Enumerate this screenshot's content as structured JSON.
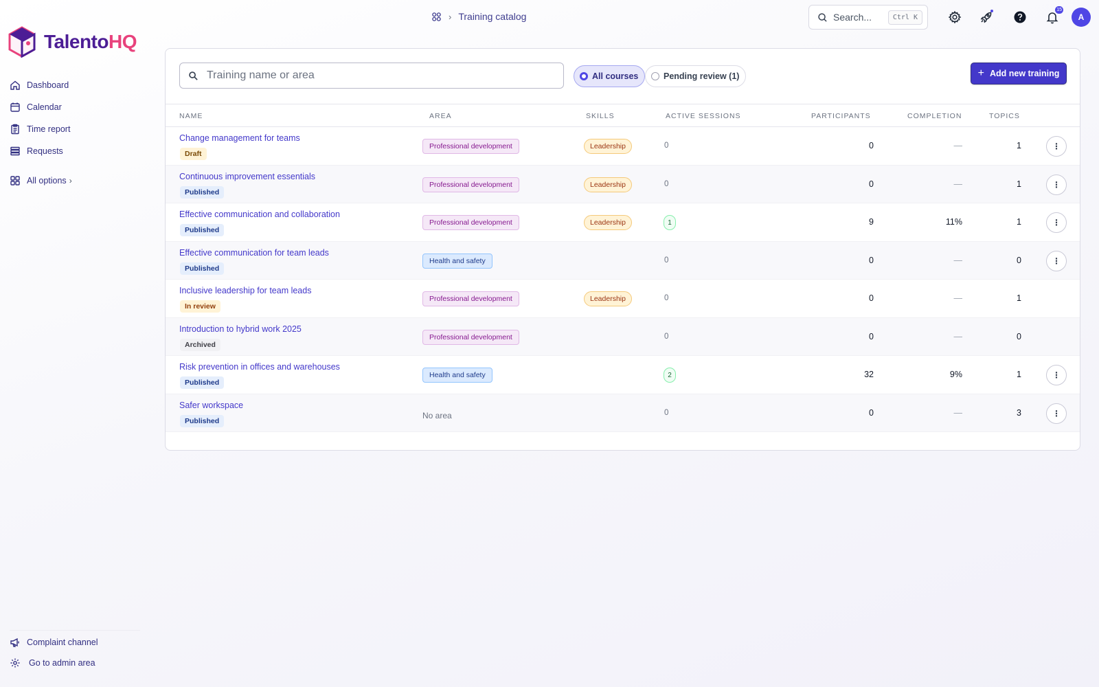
{
  "brand": {
    "name_main": "Talento",
    "name_accent": "HQ"
  },
  "sidebar": {
    "items": [
      {
        "label": "Dashboard",
        "icon": "home-icon"
      },
      {
        "label": "Calendar",
        "icon": "calendar-icon"
      },
      {
        "label": "Time report",
        "icon": "clipboard-icon"
      },
      {
        "label": "Requests",
        "icon": "stack-icon"
      }
    ],
    "all_options": "All options",
    "bottom": [
      {
        "label": "Complaint channel",
        "icon": "megaphone-icon"
      },
      {
        "label": "Go to admin area",
        "icon": "gear-icon"
      }
    ]
  },
  "header": {
    "breadcrumb_current": "Training catalog",
    "search_placeholder": "Search...",
    "search_shortcut": "Ctrl K",
    "notifications_count": "15",
    "avatar_initial": "A"
  },
  "toolbar": {
    "filter_placeholder": "Training name or area",
    "toggle_all": "All courses",
    "toggle_pending": "Pending review (1)",
    "add_button": "Add new training"
  },
  "table": {
    "columns": {
      "name": "NAME",
      "area": "AREA",
      "skills": "SKILLS",
      "sessions": "ACTIVE SESSIONS",
      "participants": "PARTICIPANTS",
      "completion": "COMPLETION",
      "topics": "TOPICS"
    },
    "rows": [
      {
        "name": "Change management for teams",
        "status": "Draft",
        "area": "Professional development",
        "skill": "Leadership",
        "sessions": "0",
        "participants": "0",
        "completion": "—",
        "topics": "1"
      },
      {
        "name": "Continuous improvement essentials",
        "status": "Published",
        "area": "Professional development",
        "skill": "Leadership",
        "sessions": "0",
        "participants": "0",
        "completion": "—",
        "topics": "1"
      },
      {
        "name": "Effective communication and collaboration",
        "status": "Published",
        "area": "Professional development",
        "skill": "Leadership",
        "sessions": "1",
        "participants": "9",
        "completion": "11%",
        "topics": "1"
      },
      {
        "name": "Effective communication for team leads",
        "status": "Published",
        "area": "Health and safety",
        "skill": "",
        "sessions": "0",
        "participants": "0",
        "completion": "—",
        "topics": "0"
      },
      {
        "name": "Inclusive leadership for team leads",
        "status": "In review",
        "area": "Professional development",
        "skill": "Leadership",
        "sessions": "0",
        "participants": "0",
        "completion": "—",
        "topics": "1"
      },
      {
        "name": "Introduction to hybrid work 2025",
        "status": "Archived",
        "area": "Professional development",
        "skill": "",
        "sessions": "0",
        "participants": "0",
        "completion": "—",
        "topics": "0"
      },
      {
        "name": "Risk prevention in offices and warehouses",
        "status": "Published",
        "area": "Health and safety",
        "skill": "",
        "sessions": "2",
        "participants": "32",
        "completion": "9%",
        "topics": "1"
      },
      {
        "name": "Safer workspace",
        "status": "Published",
        "area": "No area",
        "skill": "",
        "sessions": "0",
        "participants": "0",
        "completion": "—",
        "topics": "3"
      }
    ],
    "row_actions_visible": [
      true,
      true,
      true,
      true,
      false,
      false,
      true,
      true
    ]
  }
}
